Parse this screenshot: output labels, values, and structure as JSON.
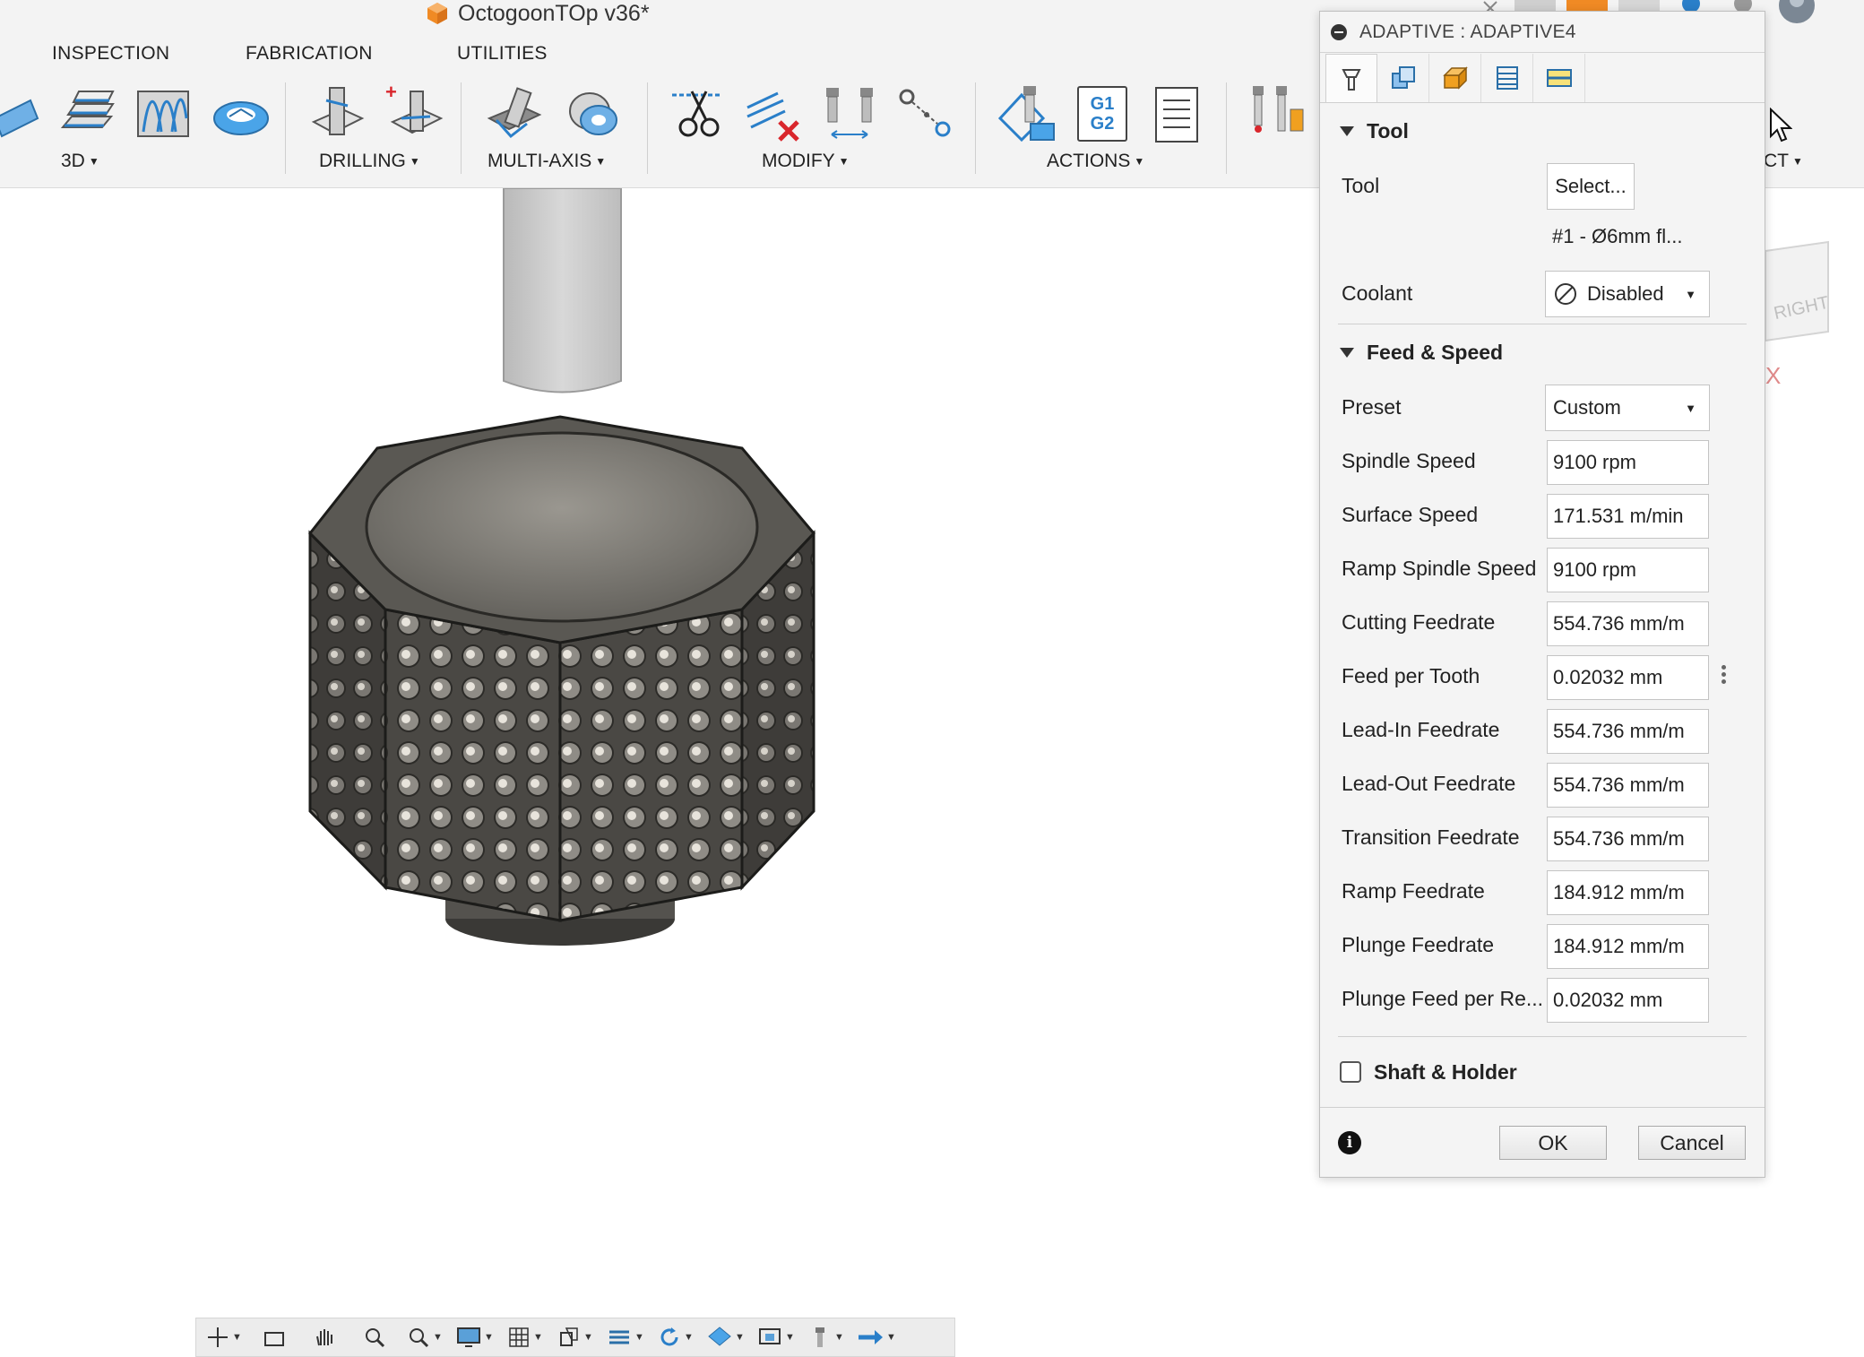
{
  "app": {
    "document_title": "OctogoonTOp v36*"
  },
  "ribbon": {
    "tabs": [
      "INSPECTION",
      "FABRICATION",
      "UTILITIES"
    ],
    "groups": [
      "3D",
      "DRILLING",
      "MULTI-AXIS",
      "MODIFY",
      "ACTIONS",
      "CT"
    ],
    "actions_icon_text": [
      "G1",
      "G2"
    ]
  },
  "viewcube": {
    "face_label": "RIGHT",
    "axis_label": "X"
  },
  "dialog": {
    "title": "ADAPTIVE : ADAPTIVE4",
    "tool_section": {
      "heading": "Tool",
      "tool_label": "Tool",
      "select_button": "Select...",
      "tool_name": "#1 - Ø6mm fl...",
      "coolant_label": "Coolant",
      "coolant_value": "Disabled"
    },
    "feed_section": {
      "heading": "Feed & Speed",
      "preset_label": "Preset",
      "preset_value": "Custom",
      "fields": [
        {
          "label": "Spindle Speed",
          "value": "9100 rpm"
        },
        {
          "label": "Surface Speed",
          "value": "171.531 m/min"
        },
        {
          "label": "Ramp Spindle Speed",
          "value": "9100 rpm"
        },
        {
          "label": "Cutting Feedrate",
          "value": "554.736 mm/m"
        },
        {
          "label": "Feed per Tooth",
          "value": "0.02032 mm"
        },
        {
          "label": "Lead-In Feedrate",
          "value": "554.736 mm/m"
        },
        {
          "label": "Lead-Out Feedrate",
          "value": "554.736 mm/m"
        },
        {
          "label": "Transition Feedrate",
          "value": "554.736 mm/m"
        },
        {
          "label": "Ramp Feedrate",
          "value": "184.912 mm/m"
        },
        {
          "label": "Plunge Feedrate",
          "value": "184.912 mm/m"
        },
        {
          "label": "Plunge Feed per Re...",
          "value": "0.02032 mm"
        }
      ]
    },
    "shaft_holder_label": "Shaft & Holder",
    "ok_label": "OK",
    "cancel_label": "Cancel"
  },
  "colors": {
    "ribbon_blue": "#2a7fc9",
    "doc_orange": "#f08a24",
    "delete_red": "#d9262c",
    "model_dark": "#4e4c48"
  }
}
